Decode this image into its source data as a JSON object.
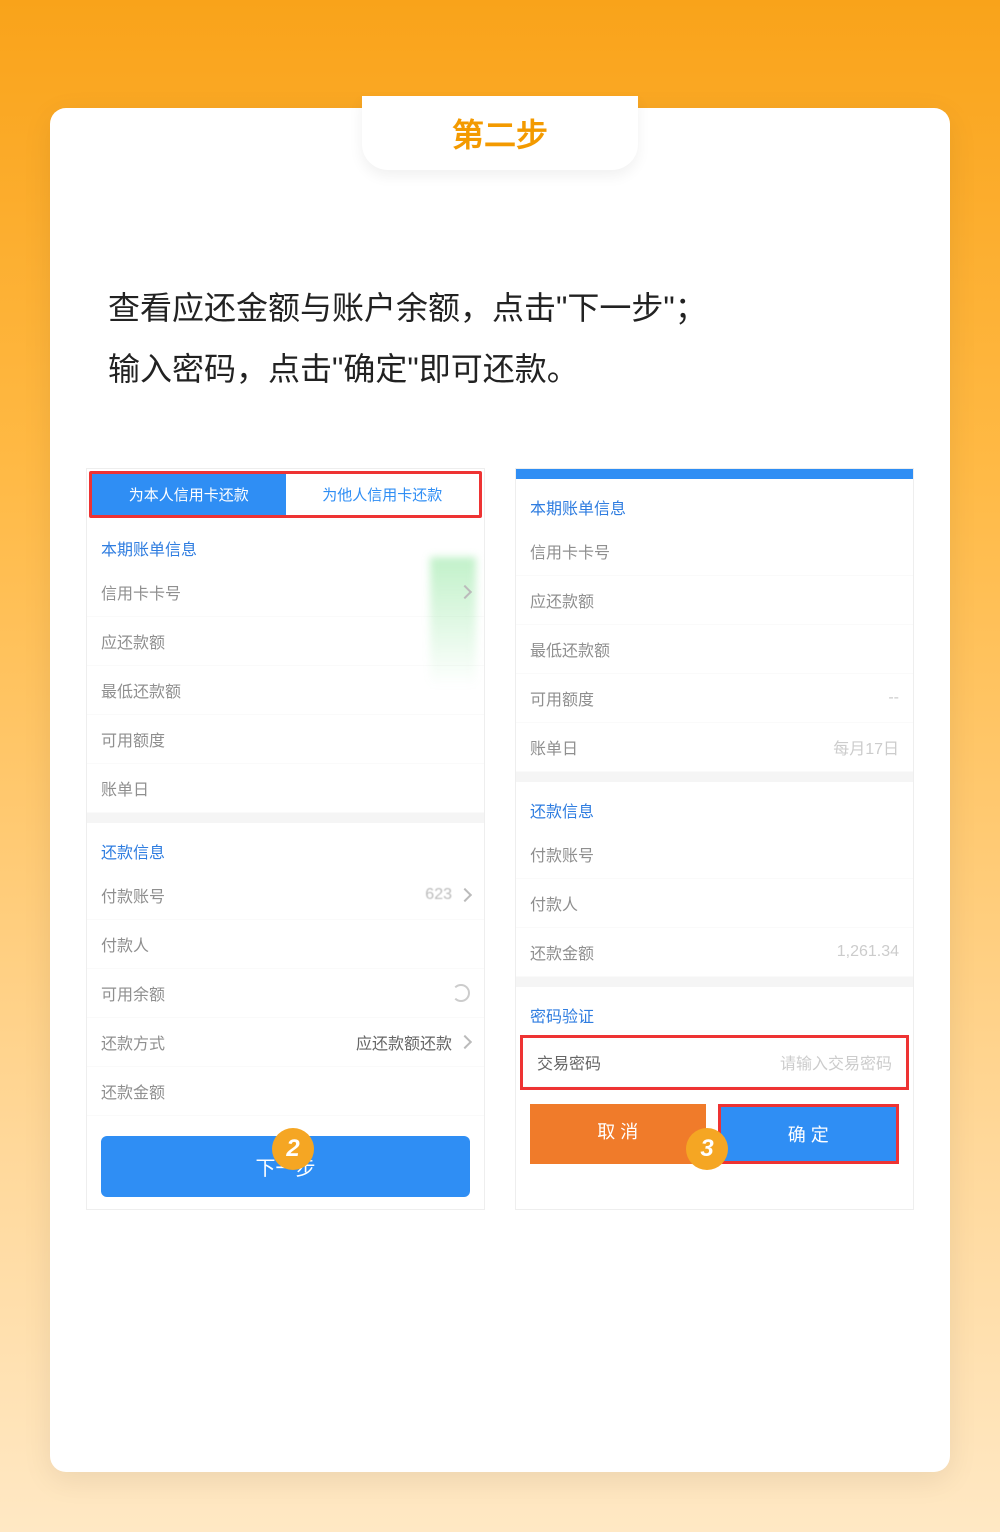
{
  "header": {
    "step_title": "第二步"
  },
  "instructions": {
    "line1": "查看应还金额与账户余额，点击\"下一步\"；",
    "line2": "输入密码，点击\"确定\"即可还款。"
  },
  "screen2": {
    "tabs": {
      "self": "为本人信用卡还款",
      "other": "为他人信用卡还款"
    },
    "section_bill": "本期账单信息",
    "fields_bill": {
      "card_no": "信用卡卡号",
      "due": "应还款额",
      "min_due": "最低还款额",
      "avail": "可用额度",
      "bill_day": "账单日"
    },
    "section_repay": "还款信息",
    "fields_repay": {
      "pay_acct": "付款账号",
      "pay_acct_val": "623",
      "payer": "付款人",
      "avail_bal": "可用余额",
      "method": "还款方式",
      "method_val": "应还款额还款",
      "amount": "还款金额"
    },
    "button": "下一步"
  },
  "screen3": {
    "section_bill": "本期账单信息",
    "fields_bill": {
      "card_no": "信用卡卡号",
      "due": "应还款额",
      "min_due": "最低还款额",
      "avail": "可用额度",
      "bill_day": "账单日",
      "bill_day_val": "每月17日"
    },
    "section_repay": "还款信息",
    "fields_repay": {
      "pay_acct": "付款账号",
      "payer": "付款人",
      "amount": "还款金额",
      "amount_val": "1,261.34"
    },
    "section_pw": "密码验证",
    "pw_label": "交易密码",
    "pw_placeholder": "请输入交易密码",
    "btn_cancel": "取 消",
    "btn_ok": "确 定"
  },
  "badges": {
    "two": "2",
    "three": "3"
  }
}
